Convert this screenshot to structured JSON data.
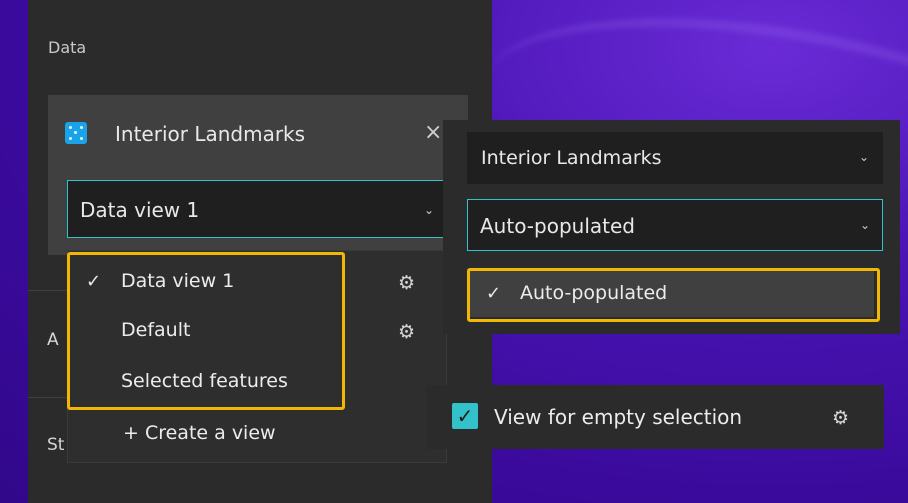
{
  "data_panel": {
    "title": "Data",
    "cut_labels": [
      "A",
      "St"
    ]
  },
  "datasource": {
    "name": "Interior Landmarks",
    "close_symbol": "×",
    "icon": "point-layer-icon",
    "selected_view": "Data view 1"
  },
  "view_dropdown": {
    "items": [
      {
        "label": "Data view 1",
        "checked": true
      },
      {
        "label": "Default",
        "checked": false
      },
      {
        "label": "Selected features",
        "checked": false
      }
    ],
    "create_label": "+ Create a view"
  },
  "right_panel": {
    "datasource_select": "Interior Landmarks",
    "view_select": "Auto-populated",
    "option": "Auto-populated"
  },
  "empty_selection": {
    "label": "View for empty selection",
    "checked": true
  },
  "colors": {
    "accent": "#33c2c9",
    "highlight": "#f2b705",
    "panel": "#2b2b2b",
    "background": "#3a0a9c"
  }
}
